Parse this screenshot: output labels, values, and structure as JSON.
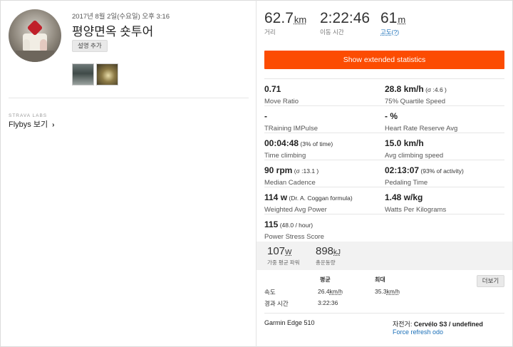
{
  "activity": {
    "date": "2017년 8월 2일(수요일) 오후 3:16",
    "title": "평양면옥 숏투어",
    "add_description_label": "설명 추가"
  },
  "labs": {
    "brand": "STRAVA LABS",
    "flybys_label": "Flybys 보기",
    "chevron": "›"
  },
  "top_stats": [
    {
      "value": "62.7",
      "unit": "km",
      "label": "거리"
    },
    {
      "value": "2:22:46",
      "unit": "",
      "label": "이동 시간"
    },
    {
      "value": "61",
      "unit": "m",
      "label": "고도(?)"
    }
  ],
  "extended_button_label": "Show extended statistics",
  "extended_stats": [
    {
      "left": {
        "value": "0.71",
        "sub": "",
        "label": "Move Ratio"
      },
      "right": {
        "value": "28.8 km/h",
        "sub": " (σ :4.6 )",
        "label": "75% Quartile Speed"
      }
    },
    {
      "left": {
        "value": "-",
        "sub": "",
        "label": "TRaining IMPulse"
      },
      "right": {
        "value": "- %",
        "sub": "",
        "label": "Heart Rate Reserve Avg"
      }
    },
    {
      "left": {
        "value": "00:04:48",
        "sub": " (3% of time)",
        "label": "Time climbing"
      },
      "right": {
        "value": "15.0 km/h",
        "sub": "",
        "label": "Avg climbing speed"
      }
    },
    {
      "left": {
        "value": "90 rpm",
        "sub": " (σ :13.1 )",
        "label": "Median Cadence"
      },
      "right": {
        "value": "02:13:07",
        "sub": " (93% of activity)",
        "label": "Pedaling Time"
      }
    },
    {
      "left": {
        "value": "114 w",
        "sub": " (Dr. A. Coggan formula)",
        "label": "Weighted Avg Power"
      },
      "right": {
        "value": "1.48 w/kg",
        "sub": "",
        "label": "Watts Per Kilograms"
      }
    },
    {
      "left": {
        "value": "115",
        "sub": " (48.0 / hour)",
        "label": "Power Stress Score"
      },
      "right": null
    }
  ],
  "power_stats": [
    {
      "value": "107",
      "unit": "W",
      "label": "가중 평균 파워"
    },
    {
      "value": "898",
      "unit": "kJ",
      "label": "총운동량"
    }
  ],
  "speed_table": {
    "headers": [
      "평균",
      "최대"
    ],
    "rows": [
      {
        "label": "속도",
        "avg": "26.4",
        "avg_unit": "km/h",
        "max": "35.3",
        "max_unit": "km/h"
      },
      {
        "label": "경과 시간",
        "avg": "3:22:36",
        "avg_unit": "",
        "max": "",
        "max_unit": ""
      }
    ],
    "more_label": "더보기"
  },
  "footer": {
    "device": "Garmin Edge 510",
    "bike_prefix": "자전거: ",
    "bike_name": "Cervélo S3 / undefined",
    "refresh_label": "Force refresh odo"
  }
}
